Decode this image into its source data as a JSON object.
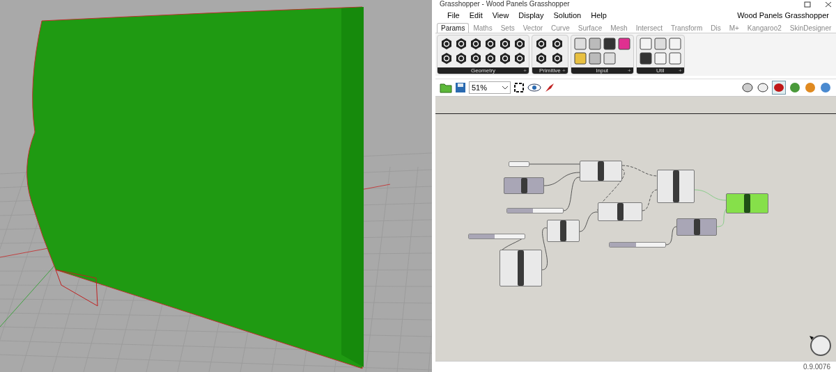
{
  "window": {
    "title": "Grasshopper - Wood Panels Grasshopper",
    "document": "Wood Panels Grasshopper"
  },
  "menu": [
    "File",
    "Edit",
    "View",
    "Display",
    "Solution",
    "Help"
  ],
  "tabs": [
    {
      "label": "Params",
      "selected": true
    },
    {
      "label": "Maths",
      "selected": false
    },
    {
      "label": "Sets",
      "selected": false
    },
    {
      "label": "Vector",
      "selected": false
    },
    {
      "label": "Curve",
      "selected": false
    },
    {
      "label": "Surface",
      "selected": false
    },
    {
      "label": "Mesh",
      "selected": false
    },
    {
      "label": "Intersect",
      "selected": false
    },
    {
      "label": "Transform",
      "selected": false
    },
    {
      "label": "Dis",
      "selected": false
    },
    {
      "label": "M+",
      "selected": false
    },
    {
      "label": "Kangaroo2",
      "selected": false
    },
    {
      "label": "SkinDesigner",
      "selected": false
    }
  ],
  "ribbon_groups": [
    {
      "label": "Geometry",
      "expander": "+"
    },
    {
      "label": "Primitive",
      "expander": "+"
    },
    {
      "label": "Input",
      "expander": "+"
    },
    {
      "label": "Util",
      "expander": "+"
    }
  ],
  "toolbar": {
    "zoom": "51%"
  },
  "nodes": [
    {
      "kind": "panel"
    },
    {
      "kind": "param"
    },
    {
      "kind": "slider",
      "level": 0.46
    },
    {
      "kind": "component"
    },
    {
      "kind": "component"
    },
    {
      "kind": "component"
    },
    {
      "kind": "component"
    },
    {
      "kind": "slider",
      "level": 0.46
    },
    {
      "kind": "component"
    },
    {
      "kind": "output"
    },
    {
      "kind": "param"
    },
    {
      "kind": "slider",
      "level": 0.47
    }
  ],
  "status_bar": {
    "version": "0.9.0076"
  }
}
